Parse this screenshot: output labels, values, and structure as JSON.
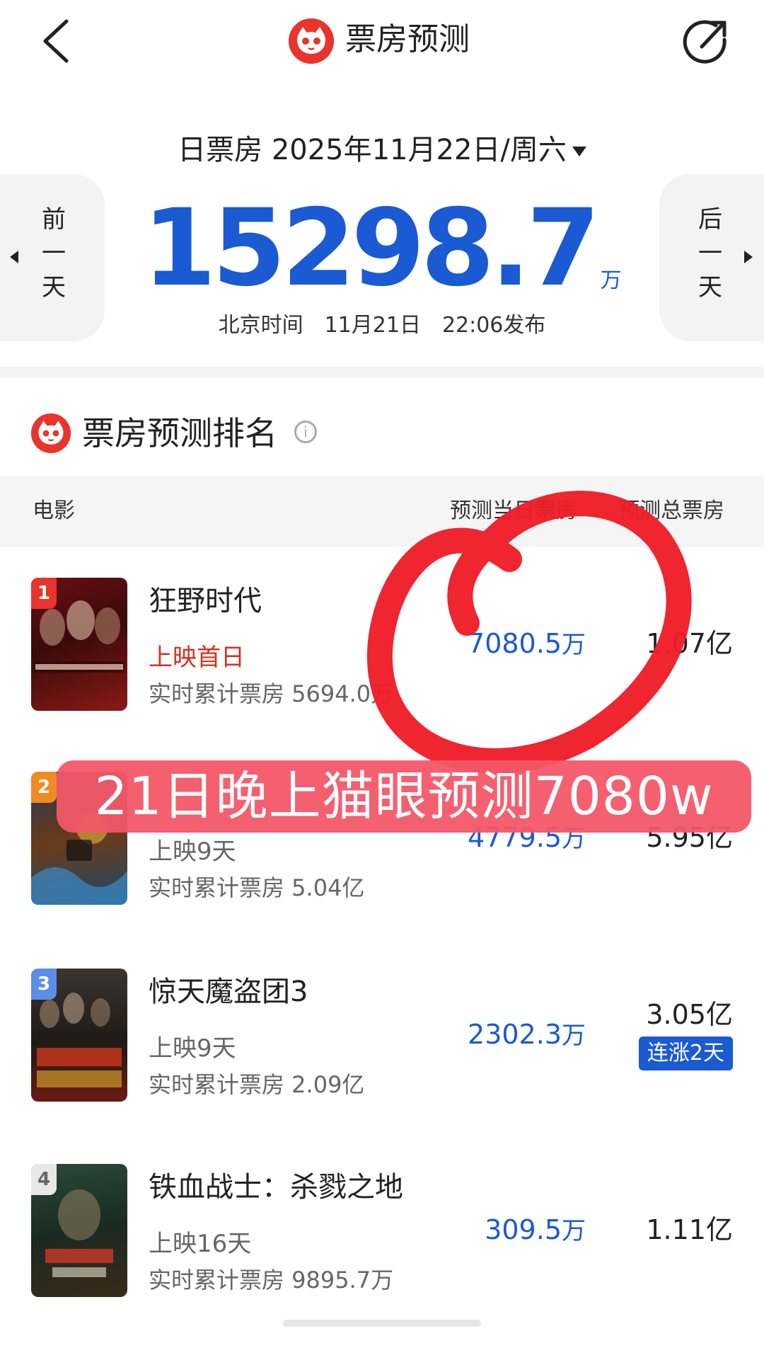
{
  "header": {
    "title": "票房预测",
    "back_icon": "chevron-left-icon",
    "share_icon": "share-arrow-icon",
    "logo_icon": "maoyan-cat-logo-icon"
  },
  "summary": {
    "label": "日票房",
    "date": "2025年11月22日/周六",
    "prev_day_label": [
      "前",
      "一",
      "天"
    ],
    "next_day_label": [
      "后",
      "一",
      "天"
    ],
    "box_office_value": "15298.7",
    "box_office_unit": "万",
    "publish_info": "北京时间　11月21日　22:06发布"
  },
  "ranking": {
    "title": "票房预测排名",
    "columns": {
      "movie": "电影",
      "predicted_day": "预测当日票房",
      "predicted_total": "预测总票房"
    },
    "rows": [
      {
        "rank": "1",
        "title": "狂野时代",
        "status": "上映首日",
        "cumulative": "实时累计票房 5694.0万",
        "predicted_day": "7080.5",
        "predicted_day_unit": "万",
        "predicted_total": "1.07亿",
        "tag": ""
      },
      {
        "rank": "2",
        "title": "",
        "status": "上映9天",
        "cumulative": "实时累计票房 5.04亿",
        "predicted_day": "4779.5",
        "predicted_day_unit": "万",
        "predicted_total": "5.95亿",
        "tag": ""
      },
      {
        "rank": "3",
        "title": "惊天魔盗团3",
        "status": "上映9天",
        "cumulative": "实时累计票房 2.09亿",
        "predicted_day": "2302.3",
        "predicted_day_unit": "万",
        "predicted_total": "3.05亿",
        "tag": "连涨2天"
      },
      {
        "rank": "4",
        "title": "铁血战士：杀戮之地",
        "status": "上映16天",
        "cumulative": "实时累计票房 9895.7万",
        "predicted_day": "309.5",
        "predicted_day_unit": "万",
        "predicted_total": "1.11亿",
        "tag": ""
      }
    ]
  },
  "annotation": {
    "banner_text": "21日晚上猫眼预测7080w",
    "scribble_color": "#ee1c28"
  },
  "colors": {
    "accent_blue": "#1a5ad2",
    "brand_red": "#e8342a",
    "status_red": "#d8301e"
  }
}
